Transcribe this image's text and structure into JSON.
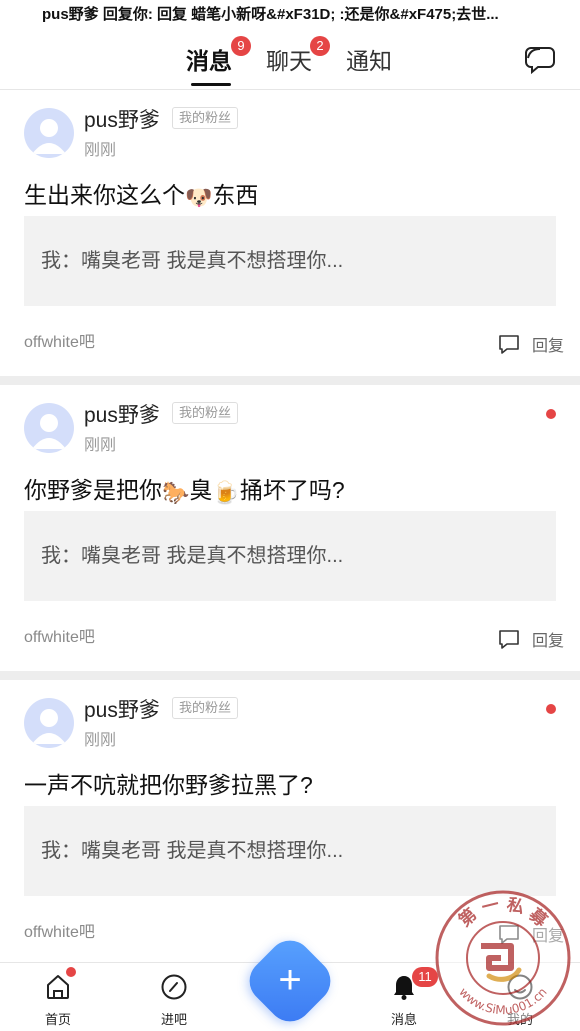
{
  "banner": {
    "text": "pus野爹 回复你: 回复 蜡笔小新呀&#xF31D; :还是你&#xF475;去世..."
  },
  "tabs": [
    {
      "label": "消息",
      "badge": "9",
      "active": true
    },
    {
      "label": "聊天",
      "badge": "2",
      "active": false
    },
    {
      "label": "通知",
      "badge": "",
      "active": false
    }
  ],
  "icons": {
    "chat": "chat-bubble-icon",
    "reply": "comment-icon",
    "home": "home-icon",
    "enter_forum": "compass-icon",
    "messages": "bell-icon",
    "profile": "profile-icon",
    "add": "plus-icon"
  },
  "colors": {
    "accent_red": "#e54545",
    "accent_blue": "#3a78f2"
  },
  "messages": [
    {
      "username": "pus野爹",
      "tag": "我的粉丝",
      "time": "刚刚",
      "text_before": "生出来你这么个",
      "emoji1": "🐶",
      "text_middle": "东西",
      "emoji2": "",
      "text_after": "",
      "quote": "我：嘴臭老哥 我是真不想搭理你...",
      "forum": "offwhite吧",
      "reply_label": "回复",
      "unread": false
    },
    {
      "username": "pus野爹",
      "tag": "我的粉丝",
      "time": "刚刚",
      "text_before": "你野爹是把你",
      "emoji1": "🐎",
      "text_middle": "臭",
      "emoji2": "🍺",
      "text_after": "捅坏了吗?",
      "quote": "我：嘴臭老哥 我是真不想搭理你...",
      "forum": "offwhite吧",
      "reply_label": "回复",
      "unread": true
    },
    {
      "username": "pus野爹",
      "tag": "我的粉丝",
      "time": "刚刚",
      "text_before": "一声不吭就把你野爹拉黑了?",
      "emoji1": "",
      "text_middle": "",
      "emoji2": "",
      "text_after": "",
      "quote": "我：嘴臭老哥 我是真不想搭理你...",
      "forum": "offwhite吧",
      "reply_label": "回复",
      "unread": true
    }
  ],
  "bottom_nav": {
    "home": {
      "label": "首页",
      "dot": true
    },
    "enter": {
      "label": "进吧"
    },
    "add": {
      "label": "+"
    },
    "messages": {
      "label": "消息",
      "badge": "11"
    },
    "profile": {
      "label": "我的"
    }
  },
  "watermark": {
    "top_text": "第 一 私 募",
    "url": "www.SiMu001.cn"
  }
}
